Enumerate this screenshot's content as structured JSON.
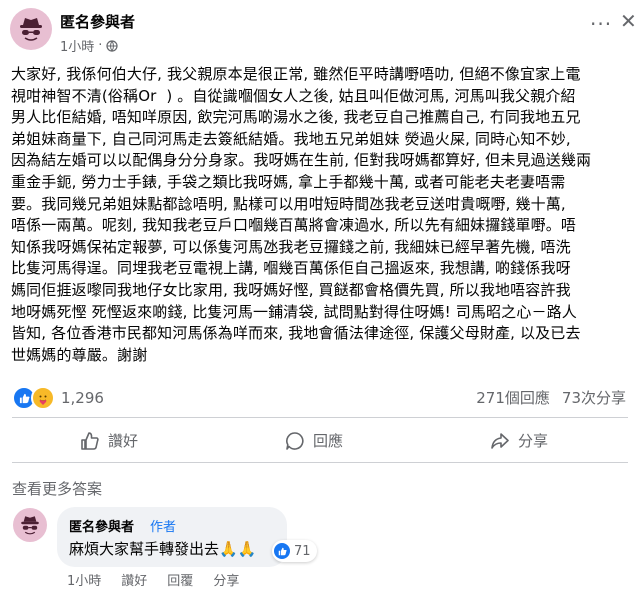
{
  "post": {
    "author": "匿名參與者",
    "time": "1小時",
    "body_lines": [
      "大家好, 我係何伯大仔, 我父親原本是很正常, 雖然佢平時講嘢唔叻, 但絕不像宜家上電",
      "視咁神智不清(俗稱Or  ) 。自從識嗰個女人之後, 姑且叫佢做河馬, 河馬叫我父親介紹",
      "男人比佢結婚, 唔知咩原因, 飲完河馬啲湯水之後, 我老豆自己推薦自己, 冇同我地五兄",
      "弟姐妹商量下, 自己同河馬走去簽紙結婚。我地五兄弟姐妹 熒過火屎, 同時心知不妙,",
      "因為結左婚可以以配偶身分分身家。我呀媽在生前, 佢對我呀媽都算好, 但未見過送幾兩",
      "重金手鈪, 勞力士手錶, 手袋之類比我呀媽, 拿上手都幾十萬, 或者可能老夫老妻唔需",
      "要。我同幾兄弟姐妹點都諗唔明, 點樣可以用咁短時間氹我老豆送咁貴嘅嘢, 幾十萬,",
      "唔係一兩萬。呢刻, 我知我老豆戶口嗰幾百萬將會凍過水, 所以先有細妹攞錢單嘢。唔",
      "知係我呀媽保祐定報夢, 可以係隻河馬氹我老豆攞錢之前, 我細妹已經早著先機, 唔洗",
      "比隻河馬得逞。同埋我老豆電視上講, 嗰幾百萬係佢自己搵返來, 我想講, 啲錢係我呀",
      "媽同佢捱返嚟同我地仔女比家用, 我呀媽好慳, 買餸都會格價先買, 所以我地唔容許我",
      "地呀媽死慳 死慳返來啲錢, 比隻河馬一鋪清袋, 試問點對得住呀媽! 司馬昭之心－路人",
      "皆知, 各位香港市民都知河馬係為咩而來, 我地會循法律途徑, 保護父母財產, 以及已去",
      "世媽媽的尊嚴。謝謝"
    ]
  },
  "reactions": {
    "count": "1,296"
  },
  "stats": {
    "comments": "271個回應",
    "shares": "73次分享"
  },
  "actions": {
    "like": "讚好",
    "comment": "回應",
    "share": "分享"
  },
  "comments_section": {
    "more_label": "查看更多答案",
    "comment": {
      "author": "匿名參與者",
      "badge": "作者",
      "text": "麻煩大家幫手轉發出去🙏🙏",
      "reaction_count": "71",
      "time": "1小時",
      "like_label": "讚好",
      "reply_label": "回覆",
      "share_label": "分享"
    }
  },
  "colors": {
    "accent": "#1877f2",
    "muted": "#65676b",
    "avatar_bg": "#e8bfd2"
  },
  "icons": [
    "anonymous-avatar-icon",
    "globe-icon",
    "more-icon",
    "close-icon",
    "like-icon",
    "comment-icon",
    "share-icon",
    "like-reaction-icon",
    "care-reaction-icon"
  ]
}
